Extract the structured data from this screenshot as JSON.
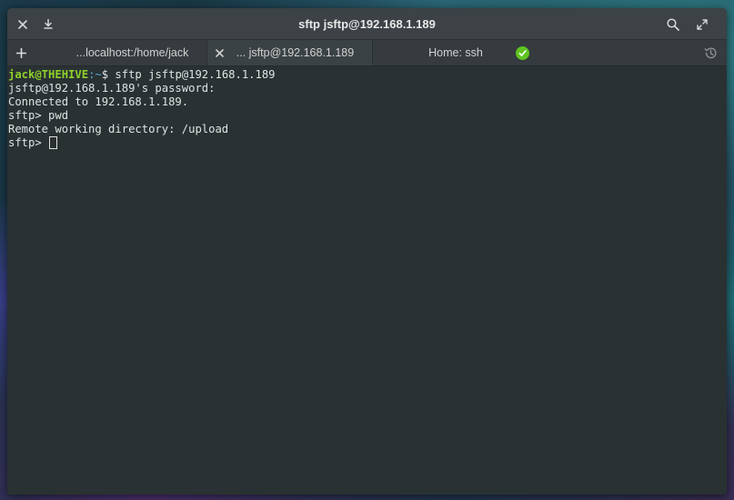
{
  "window": {
    "title": "sftp jsftp@192.168.1.189"
  },
  "tabs": [
    {
      "label": "...localhost:/home/jack",
      "active": false
    },
    {
      "label": "... jsftp@192.168.1.189",
      "active": true
    },
    {
      "label": "Home: ssh",
      "active": false,
      "status": "success"
    }
  ],
  "terminal": {
    "line1": {
      "user": "jack@THEHIVE",
      "sep": ":",
      "path": "~",
      "command": "$ sftp jsftp@192.168.1.189"
    },
    "line2": "jsftp@192.168.1.189's password:",
    "line3": "Connected to 192.168.1.189.",
    "line4": "sftp> pwd",
    "line5": "Remote working directory: /upload",
    "line6": "sftp> "
  },
  "colors": {
    "prompt_user": "#8ed02a",
    "prompt_path": "#56a8d9",
    "status_ok": "#5fc41f",
    "terminal_bg": "#2a3133"
  },
  "icons": {
    "close": "close-icon",
    "download": "download-icon",
    "search": "search-icon",
    "maximize": "maximize-icon",
    "new_tab": "plus-icon",
    "history": "history-icon",
    "status": "checkmark-icon"
  }
}
